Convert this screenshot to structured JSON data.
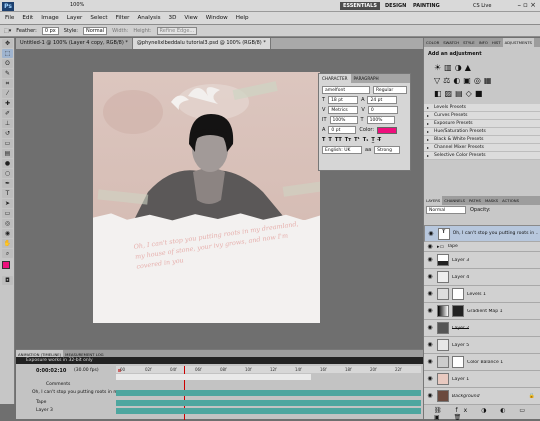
{
  "app": {
    "logo": "Ps",
    "zoom": "100%",
    "workspace": [
      "ESSENTIALS",
      "DESIGN",
      "PAINTING"
    ],
    "live": "CS Live"
  },
  "menu": [
    "File",
    "Edit",
    "Image",
    "Layer",
    "Select",
    "Filter",
    "Analysis",
    "3D",
    "View",
    "Window",
    "Help"
  ],
  "options": {
    "feather_label": "Feather:",
    "feather": "0 px",
    "style_label": "Style:",
    "style": "Normal",
    "width_label": "Width:",
    "height_label": "Height:",
    "refine": "Refine Edge..."
  },
  "doc_tabs": [
    "Untitled-1 @ 100% (Layer 4 copy, RGB/8) *",
    "@phynelixlbeddalu tutorial3.psd @ 100% (RGB/8) *"
  ],
  "lyric": "Oh, I can't stop you putting roots in my dreamland, my house of stone, your ivy grows, and now I'm covered in you",
  "character": {
    "tabs": [
      "CHARACTER",
      "PARAGRAPH"
    ],
    "font": "amelfont",
    "style": "Regular",
    "size": "18 pt",
    "leading": "24 pt",
    "kerning": "Metrics",
    "tracking": "0",
    "vscale": "100%",
    "hscale": "100%",
    "baseline": "0 pt",
    "color_label": "Color:",
    "language": "English: UK",
    "aa_label": "aa",
    "aa": "Strong",
    "color": "#ee0f7c"
  },
  "adjust": {
    "tabs": [
      "COLOR",
      "SWATCH",
      "STYLE",
      "INFO",
      "HIST",
      "ADJUSTMENTS"
    ],
    "title": "Add an adjustment",
    "presets": [
      "Levels Presets",
      "Curves Presets",
      "Exposure Presets",
      "Hue/Saturation Presets",
      "Black & White Presets",
      "Channel Mixer Presets",
      "Selective Color Presets"
    ]
  },
  "layers": {
    "tabs": [
      "LAYERS",
      "CHANNELS",
      "PATHS",
      "MASKS",
      "ACTIONS"
    ],
    "blend": "Normal",
    "opacity": "Opacity:",
    "items": [
      "Oh, I can't stop you putting roots in ...",
      "Tape",
      "Layer 3",
      "Layer 4",
      "Levels 1",
      "Gradient Map 1",
      "Layer 2",
      "Layer 5",
      "Color Balance 1",
      "Layer 1",
      "Background"
    ]
  },
  "anim": {
    "tabs": [
      "ANIMATION (TIMELINE)",
      "MEASUREMENT LOG"
    ],
    "status": "Exposure works in 32-bit only",
    "time": "0:00:02:10",
    "fps": "(30.00 fps)",
    "rows": [
      "Comments",
      "Oh, I can't stop you putting roots in my",
      "Tape",
      "Layer 3"
    ],
    "ticks": [
      "00",
      "02f",
      "04f",
      "06f",
      "08f",
      "10f",
      "12f",
      "14f",
      "16f",
      "18f",
      "20f",
      "22f"
    ]
  }
}
